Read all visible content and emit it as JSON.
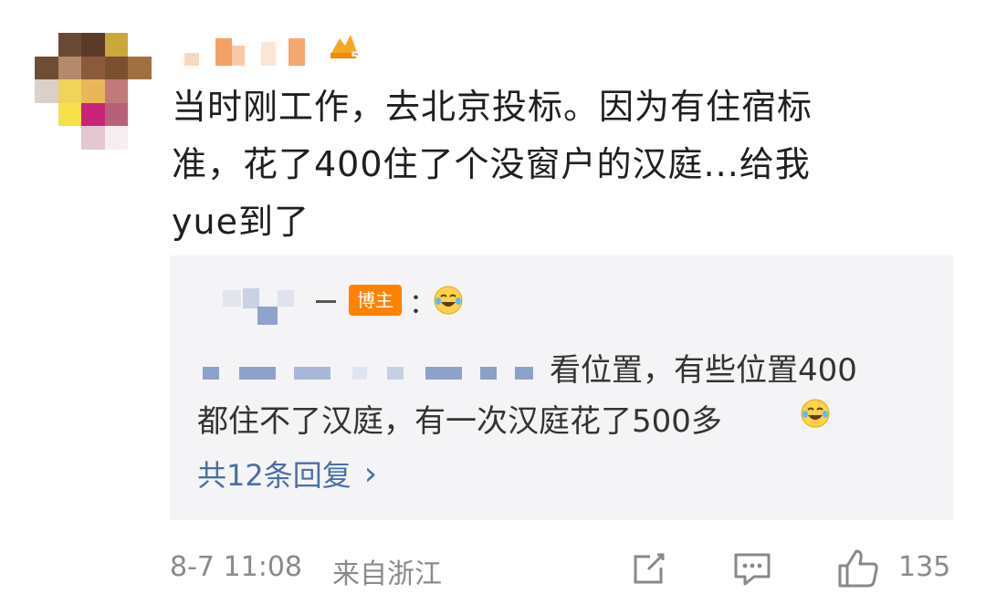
{
  "comment": {
    "text_line1": "当时刚工作，去北京投标。因为有住宿标",
    "text_line2": "准，花了400住了个没窗户的汉庭...给我",
    "text_line3": "yue到了"
  },
  "reply": {
    "badge": "博主",
    "colon": "：",
    "text_part1": "看位置，有些位置400",
    "text_part2": "都住不了汉庭，有一次汉庭花了500多",
    "more_label": "共12条回复",
    "more_chevron": "›"
  },
  "footer": {
    "time": "8-7 11:08",
    "source": "来自浙江",
    "like_count": "135"
  },
  "colors": {
    "accent_link": "#4a6fa5",
    "badge_orange": "#ff8200",
    "reply_bg": "#f4f4f6",
    "meta_gray": "#8a8a8a"
  },
  "icons": [
    "avatar",
    "vip-badge-icon",
    "laugh-cry-emoji-icon",
    "share-icon",
    "comment-icon",
    "like-icon",
    "chevron-right-icon"
  ]
}
